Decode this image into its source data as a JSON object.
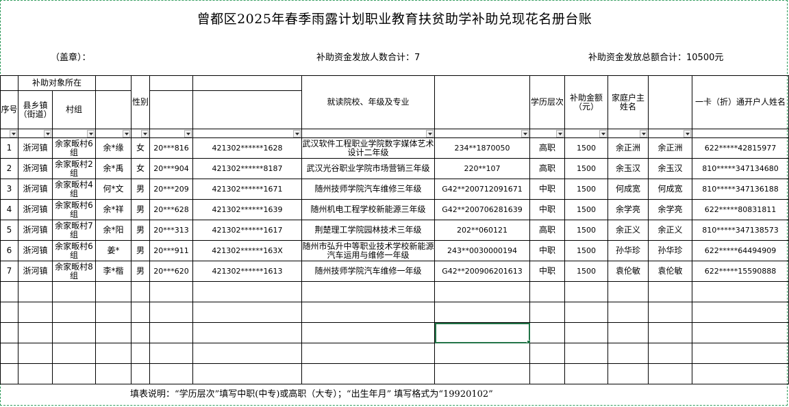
{
  "title": "曾都区2025年春季雨露计划职业教育扶贫助学补助兑现花名册台账",
  "meta": {
    "seal": "（盖章）：",
    "count_label": "补助资金发放人数合计：7",
    "total_label": "补助资金发放总额合计：10500元"
  },
  "headers": {
    "group": "补助对象所在",
    "seq": "序号",
    "town": "县乡镇（街道）",
    "village": "村组",
    "gender": "性别",
    "school": "就读院校、年级及专业",
    "edu": "学历层次",
    "amount": "补助金额（元）",
    "household": "家庭户主姓名",
    "card_holder": "一卡（折）通开户人姓名"
  },
  "rows": [
    {
      "seq": "1",
      "town": "浙河镇",
      "village": "余家畈村6组",
      "name": "余*缘",
      "gender": "女",
      "birth": "20***816",
      "id": "421302******1628",
      "school": "武汉软件工程职业学院数字媒体艺术设计二年级",
      "student_no": "234**1870050",
      "edu": "高职",
      "amount": "1500",
      "household": "余正洲",
      "holder": "余正洲",
      "card": "622*****42815977"
    },
    {
      "seq": "2",
      "town": "浙河镇",
      "village": "余家畈村2组",
      "name": "余*禹",
      "gender": "女",
      "birth": "20***904",
      "id": "421302******8187",
      "school": "武汉光谷职业学院市场营销三年级",
      "student_no": "220**107",
      "edu": "高职",
      "amount": "1500",
      "household": "余玉汉",
      "holder": "余玉汉",
      "card": "810*****347134680"
    },
    {
      "seq": "3",
      "town": "浙河镇",
      "village": "余家畈村4组",
      "name": "何*文",
      "gender": "男",
      "birth": "20***209",
      "id": "421302******1671",
      "school": "随州技师学院汽车维修三年级",
      "student_no": "G42**200712091671",
      "edu": "中职",
      "amount": "1500",
      "household": "何成宽",
      "holder": "何成宽",
      "card": "810*****347136188"
    },
    {
      "seq": "4",
      "town": "浙河镇",
      "village": "余家畈村6组",
      "name": "余*祥",
      "gender": "男",
      "birth": "20***628",
      "id": "421302******1639",
      "school": "随州机电工程学校新能源三年级",
      "student_no": "G42**200706281639",
      "edu": "中职",
      "amount": "1500",
      "household": "余学亮",
      "holder": "余学亮",
      "card": "622*****80831811"
    },
    {
      "seq": "5",
      "town": "浙河镇",
      "village": "余家畈村7组",
      "name": "余*阳",
      "gender": "男",
      "birth": "20***313",
      "id": "421302******1617",
      "school": "荆楚理工学院园林技术三年级",
      "student_no": "202**060121",
      "edu": "高职",
      "amount": "1500",
      "household": "余正义",
      "holder": "余正义",
      "card": "810*****347138573"
    },
    {
      "seq": "6",
      "town": "浙河镇",
      "village": "余家畈村6组",
      "name": "姜*",
      "gender": "男",
      "birth": "20***911",
      "id": "421302******163X",
      "school": "随州市弘升中等职业技术学校新能源汽车运用与维修一年级",
      "student_no": "243**0030000194",
      "edu": "中职",
      "amount": "1500",
      "household": "孙华珍",
      "holder": "孙华珍",
      "card": "622*****64494909"
    },
    {
      "seq": "7",
      "town": "浙河镇",
      "village": "余家畈村8组",
      "name": "李*楷",
      "gender": "男",
      "birth": "20***620",
      "id": "421302******1613",
      "school": "随州技师学院汽车维修一年级",
      "student_no": "G42**200906201613",
      "edu": "中职",
      "amount": "1500",
      "household": "袁伦敏",
      "holder": "袁伦敏",
      "card": "622*****15590888"
    }
  ],
  "note": "填表说明：“学历层次”填写中职(中专)或高职（大专）；“出生年月” 填写格式为“19920102”"
}
